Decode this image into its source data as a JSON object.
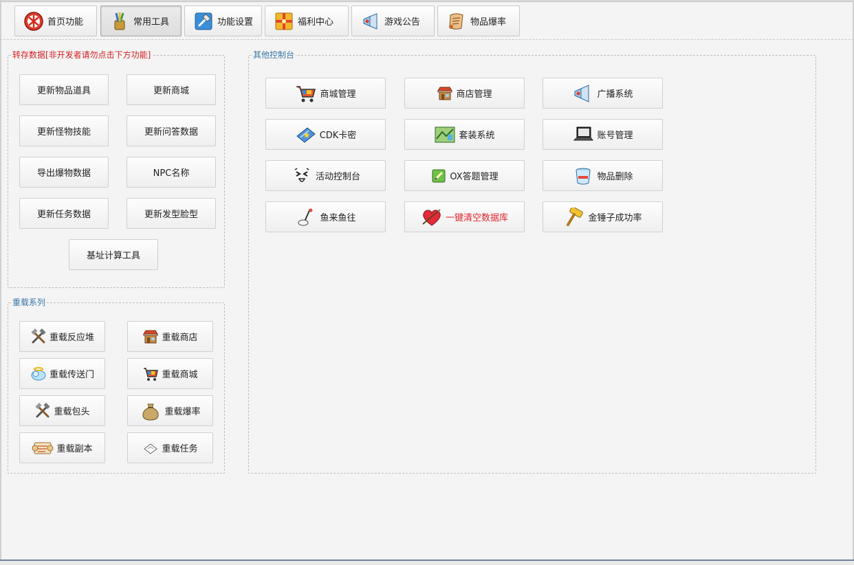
{
  "tabs": [
    {
      "label": "首页功能",
      "icon": "home-badge-icon",
      "active": false
    },
    {
      "label": "常用工具",
      "icon": "tools-icon",
      "active": true
    },
    {
      "label": "功能设置",
      "icon": "settings-hammer-icon",
      "active": false
    },
    {
      "label": "福利中心",
      "icon": "gift-box-icon",
      "active": false
    },
    {
      "label": "游戏公告",
      "icon": "megaphone-icon",
      "active": false
    },
    {
      "label": "物品爆率",
      "icon": "scroll-icon",
      "active": false
    }
  ],
  "dump_group": {
    "legend": "转存数据[非开发者请勿点击下方功能]",
    "buttons": [
      "更新物品道具",
      "更新商城",
      "更新怪物技能",
      "更新问答数据",
      "导出爆物数据",
      "NPC名称",
      "更新任务数据",
      "更新发型脸型",
      "基址计算工具"
    ]
  },
  "reload_group": {
    "legend": "重载系列",
    "buttons": [
      {
        "label": "重载反应堆",
        "icon": "crossed-tools-icon"
      },
      {
        "label": "重载商店",
        "icon": "shop-stall-icon"
      },
      {
        "label": "重载传送门",
        "icon": "cloud-portal-icon"
      },
      {
        "label": "重载商城",
        "icon": "shopping-cart-icon"
      },
      {
        "label": "重载包头",
        "icon": "crossed-tools-icon"
      },
      {
        "label": "重载爆率",
        "icon": "money-bag-icon"
      },
      {
        "label": "重载副本",
        "icon": "scroll-icon"
      },
      {
        "label": "重载任务",
        "icon": "quest-book-icon"
      }
    ]
  },
  "console_group": {
    "legend": "其他控制台",
    "buttons": [
      {
        "label": "商城管理",
        "icon": "shopping-cart-icon"
      },
      {
        "label": "商店管理",
        "icon": "shop-stall-icon"
      },
      {
        "label": "广播系统",
        "icon": "megaphone-icon"
      },
      {
        "label": "CDK卡密",
        "icon": "card-icon"
      },
      {
        "label": "套装系统",
        "icon": "map-icon"
      },
      {
        "label": "账号管理",
        "icon": "laptop-icon"
      },
      {
        "label": "活动控制台",
        "icon": "face-icon"
      },
      {
        "label": "OX答题管理",
        "icon": "pencil-note-icon"
      },
      {
        "label": "物品删除",
        "icon": "trash-can-icon"
      },
      {
        "label": "鱼来鱼往",
        "icon": "fishing-icon"
      },
      {
        "label": "一键清空数据库",
        "icon": "heart-arrow-icon",
        "danger": true
      },
      {
        "label": "金锤子成功率",
        "icon": "golden-hammer-icon"
      }
    ]
  },
  "colors": {
    "legend_red": "#d21f1f",
    "legend_blue": "#3a77a8",
    "danger_text": "#e1262e",
    "bottom_border": "#6f8198"
  }
}
